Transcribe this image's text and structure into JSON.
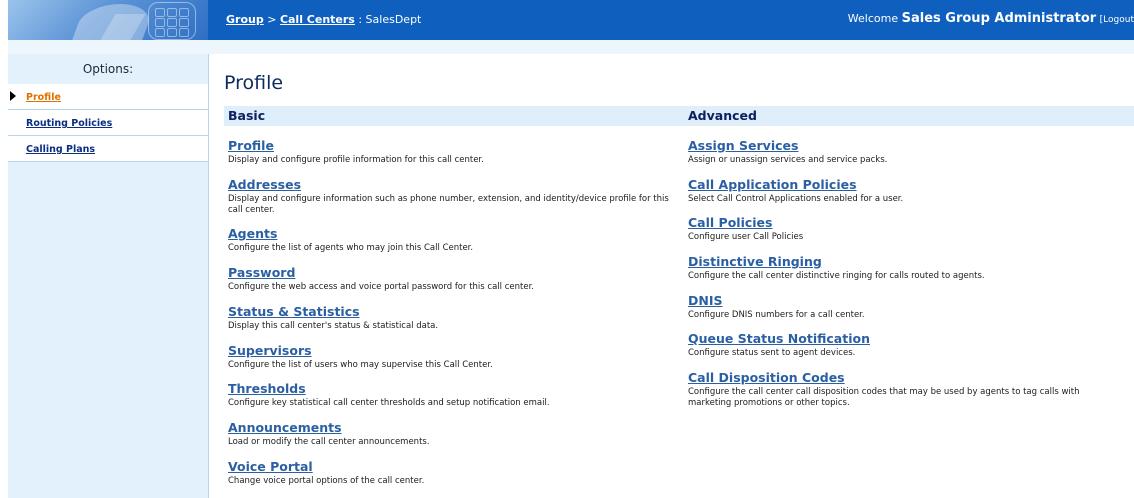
{
  "header": {
    "breadcrumb_group": "Group",
    "breadcrumb_sep": ">",
    "breadcrumb_call_centers": "Call Centers",
    "breadcrumb_current": ": SalesDept",
    "welcome_prefix": "Welcome",
    "welcome_name": "Sales Group Administrator",
    "logout": "[Logout"
  },
  "sidebar": {
    "title": "Options:",
    "items": [
      {
        "label": "Profile",
        "active": true
      },
      {
        "label": "Routing Policies",
        "active": false
      },
      {
        "label": "Calling Plans",
        "active": false
      }
    ]
  },
  "page_title": "Profile",
  "basic": {
    "heading": "Basic",
    "items": [
      {
        "name": "Profile",
        "desc": "Display and configure profile information for this call center."
      },
      {
        "name": "Addresses",
        "desc": "Display and configure information such as phone number, extension, and identity/device profile for this call center."
      },
      {
        "name": "Agents",
        "desc": "Configure the list of agents who may join this Call Center."
      },
      {
        "name": "Password",
        "desc": "Configure the web access and voice portal password for this call center."
      },
      {
        "name": "Status & Statistics",
        "desc": "Display this call center's status & statistical data."
      },
      {
        "name": "Supervisors",
        "desc": "Configure the list of users who may supervise this Call Center."
      },
      {
        "name": "Thresholds",
        "desc": "Configure key statistical call center thresholds and setup notification email."
      },
      {
        "name": "Announcements",
        "desc": "Load or modify the call center announcements."
      },
      {
        "name": "Voice Portal",
        "desc": "Change voice portal options of the call center."
      }
    ]
  },
  "advanced": {
    "heading": "Advanced",
    "items": [
      {
        "name": "Assign Services",
        "desc": "Assign or unassign services and service packs."
      },
      {
        "name": "Call Application Policies",
        "desc": "Select Call Control Applications enabled for a user."
      },
      {
        "name": "Call Policies",
        "desc": "Configure user Call Policies"
      },
      {
        "name": "Distinctive Ringing",
        "desc": "Configure the call center distinctive ringing for calls routed to agents."
      },
      {
        "name": "DNIS",
        "desc": "Configure DNIS numbers for a call center."
      },
      {
        "name": "Queue Status Notification",
        "desc": "Configure status sent to agent devices."
      },
      {
        "name": "Call Disposition Codes",
        "desc": "Configure the call center call disposition codes that may be used by agents to tag calls with marketing promotions or other topics."
      }
    ]
  }
}
